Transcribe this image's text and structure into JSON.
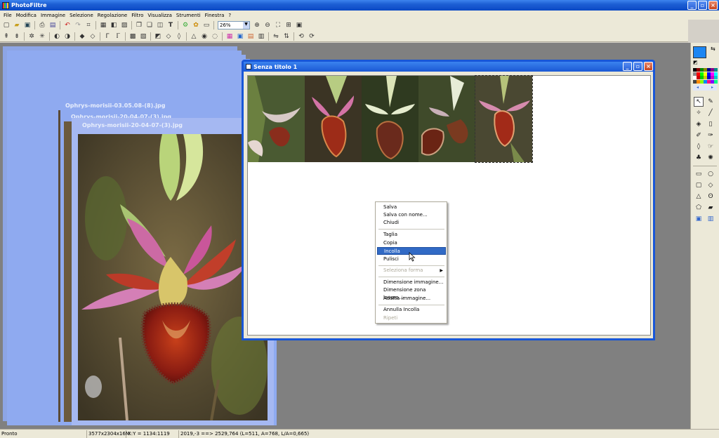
{
  "app": {
    "title": "PhotoFiltre"
  },
  "menu": [
    "File",
    "Modifica",
    "Immagine",
    "Selezione",
    "Regolazione",
    "Filtro",
    "Visualizza",
    "Strumenti",
    "Finestra",
    "?"
  ],
  "toolbar": {
    "zoom_value": "26%"
  },
  "windows": {
    "stack_title_1": "Ophrys-morisii-03.05.08-(8).jpg",
    "stack_title_2": "Ophrys-morisii-20-04-07-(3).jpg",
    "active_title": "Senza titolo 1"
  },
  "context_menu": {
    "items": [
      {
        "label": "Salva",
        "enabled": true
      },
      {
        "label": "Salva con nome...",
        "enabled": true
      },
      {
        "label": "Chiudi",
        "enabled": true
      },
      {
        "label": "Taglia",
        "enabled": true
      },
      {
        "label": "Copia",
        "enabled": true
      },
      {
        "label": "Incolla",
        "enabled": true,
        "highlighted": true
      },
      {
        "label": "Pulisci",
        "enabled": true
      },
      {
        "label": "Seleziona forma",
        "enabled": false,
        "submenu": true
      },
      {
        "label": "Dimensione immagine...",
        "enabled": true
      },
      {
        "label": "Dimensione zona lavoro...",
        "enabled": true
      },
      {
        "label": "Adatta immagine...",
        "enabled": true
      },
      {
        "label": "Annulla Incolla",
        "enabled": true
      },
      {
        "label": "Ripeti",
        "enabled": false
      }
    ]
  },
  "statusbar": {
    "state": "Pronto",
    "image_size": "3577x2304x16M",
    "cursor": "X:Y = 1134:1119",
    "selection": "2019,-3 ==> 2529,764 (L=511, A=768, L/A=0,665)"
  },
  "colors": {
    "foreground": "#1c86f2",
    "background": "#ffffff",
    "title_active": "#1856d8",
    "title_inactive": "#8faaf0",
    "workspace": "#808080"
  }
}
